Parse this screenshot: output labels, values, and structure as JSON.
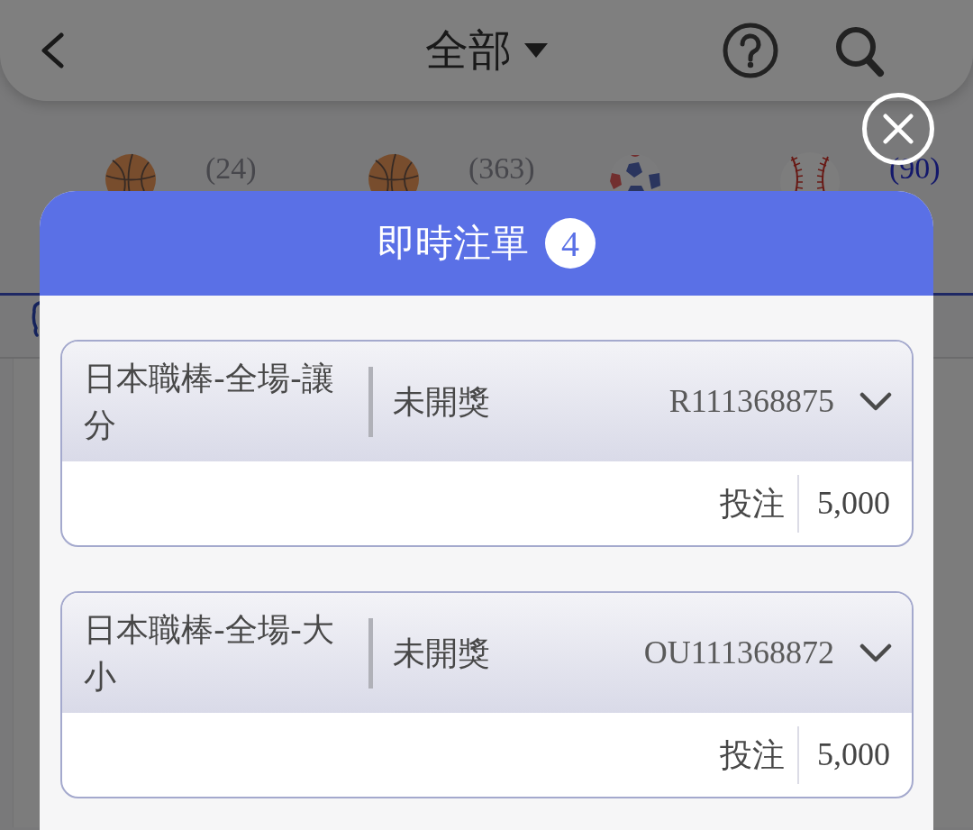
{
  "header": {
    "title": "全部"
  },
  "sport_tabs": [
    {
      "kind": "basketball",
      "count": "(24)",
      "selected": false
    },
    {
      "kind": "basketball",
      "count": "(363)",
      "selected": false
    },
    {
      "kind": "soccer",
      "selected": false
    },
    {
      "kind": "baseball",
      "count": "(90)",
      "selected": true
    }
  ],
  "modal": {
    "title": "即時注單",
    "badge": "4",
    "bets": [
      {
        "market": "日本職棒-全場-讓分",
        "status": "未開獎",
        "bet_id": "R111368875",
        "stake_label": "投注",
        "stake": "5,000",
        "expanded": false
      },
      {
        "market": "日本職棒-全場-大小",
        "status": "未開獎",
        "bet_id": "OU111368872",
        "stake_label": "投注",
        "stake": "5,000",
        "expanded": false
      }
    ]
  }
}
